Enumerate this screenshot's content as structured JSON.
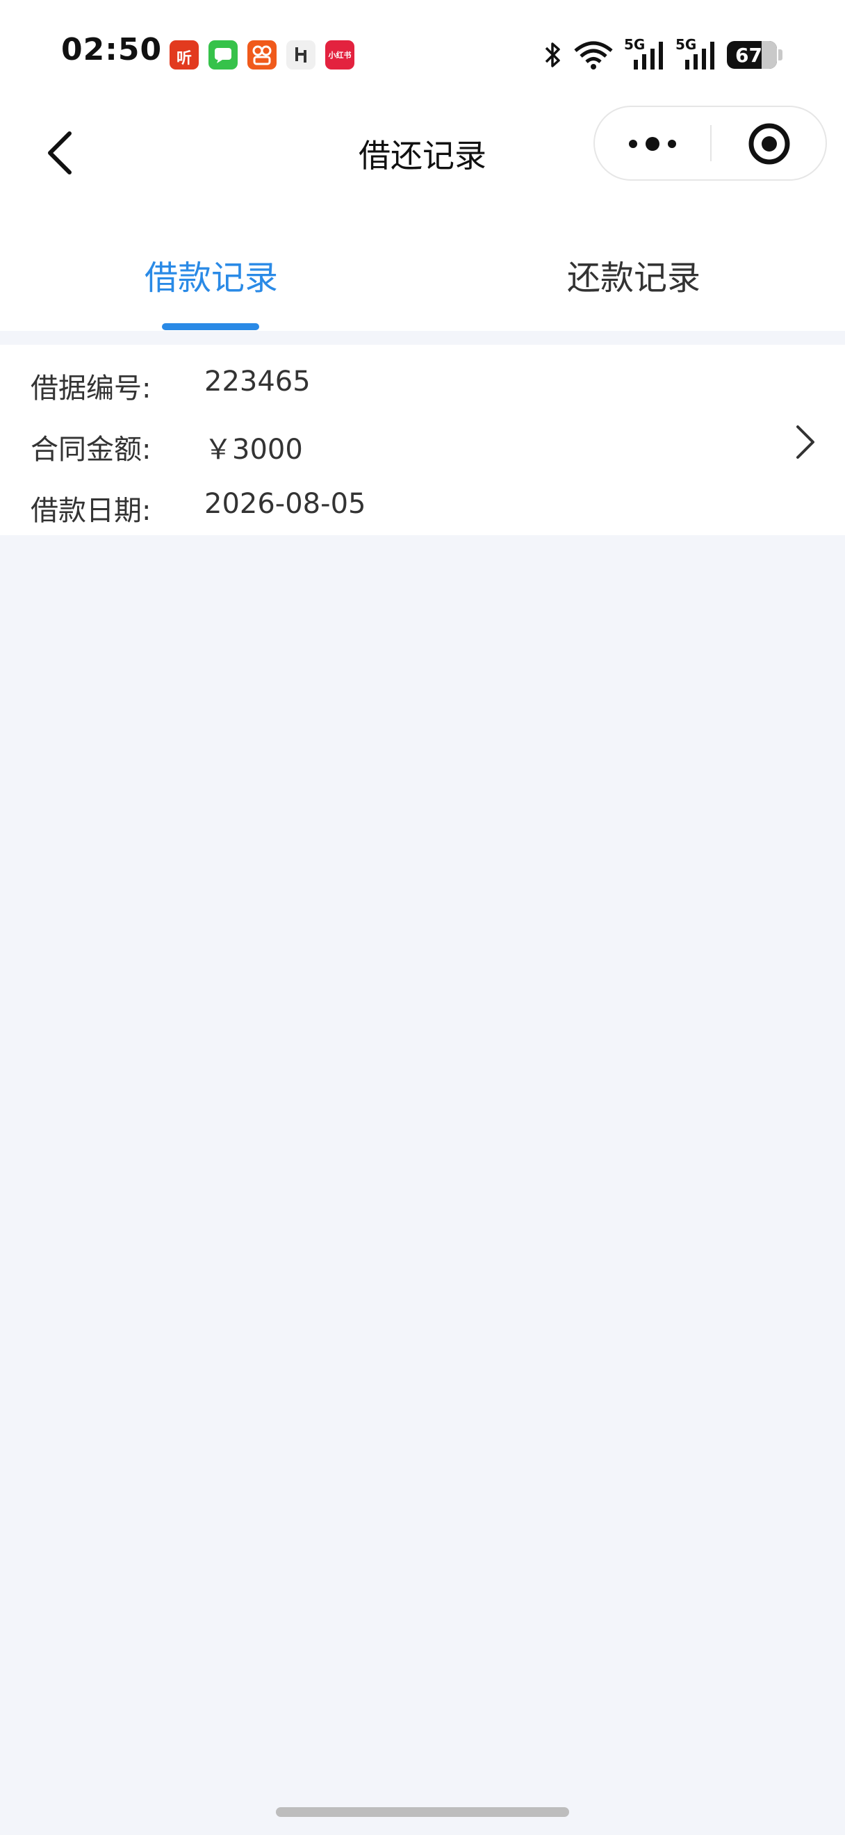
{
  "status_bar": {
    "time": "02:50",
    "battery": "67",
    "network_1": "5G",
    "network_2": "5G",
    "notifications": [
      {
        "icon": "ximalaya-app-icon",
        "glyph": "听"
      },
      {
        "icon": "messages-app-icon",
        "glyph": ""
      },
      {
        "icon": "taobao-app-icon",
        "glyph": ""
      },
      {
        "icon": "app-icon",
        "glyph": ""
      },
      {
        "icon": "xiaohongshu-app-icon",
        "glyph": "小红书"
      }
    ]
  },
  "nav": {
    "title": "借还记录"
  },
  "tabs": [
    {
      "label": "借款记录",
      "active": true
    },
    {
      "label": "还款记录",
      "active": false
    }
  ],
  "records": [
    {
      "rows": [
        {
          "label": "借据编号:",
          "value": "223465"
        },
        {
          "label": "合同金额:",
          "value": "￥3000"
        },
        {
          "label": "借款日期:",
          "value": "2026-08-05"
        }
      ]
    }
  ],
  "colors": {
    "accent": "#2a8ae6",
    "background": "#f3f5fa"
  }
}
